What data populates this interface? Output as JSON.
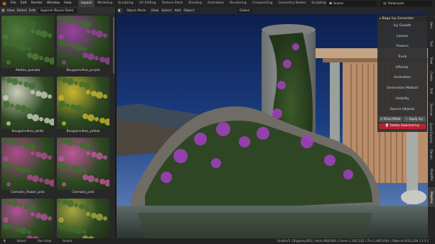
{
  "menubar": {
    "menus": [
      "File",
      "Edit",
      "Render",
      "Window",
      "Help"
    ],
    "workspaces": [
      "Layout",
      "Modeling",
      "Sculpting",
      "UV Editing",
      "Texture Paint",
      "Shading",
      "Animation",
      "Rendering",
      "Compositing",
      "Geometry Nodes",
      "Scripting"
    ],
    "active_workspace": "Layout",
    "scene": "Scene",
    "view_layer": "ViewLayer"
  },
  "asset_browser": {
    "header": {
      "view": "View",
      "select": "Select",
      "edit": "Edit",
      "import_mode": "Append (Reuse Data)"
    },
    "assets": [
      {
        "label": "Akebia_quinata",
        "palette": "#4e7a3a"
      },
      {
        "label": "Bougainvillea_purple",
        "palette": "#9b3fa3"
      },
      {
        "label": "Bougainvillea_white",
        "palette": "#c9cdb9"
      },
      {
        "label": "Bougainvillea_yellow",
        "palette": "#c7b62f"
      },
      {
        "label": "Clematis_flower_pink",
        "palette": "#b04a8e"
      },
      {
        "label": "Clematis_pink",
        "palette": "#c0569c"
      },
      {
        "label": "",
        "palette": "#b4509a"
      },
      {
        "label": "",
        "palette": "#a9a540"
      }
    ]
  },
  "viewport": {
    "header": {
      "view_icon": "cube-icon",
      "mode": "Object Mode",
      "view": "View",
      "select": "Select",
      "add": "Add",
      "object": "Object",
      "orientation": "Global"
    }
  },
  "baga_panel": {
    "title": "Baga Ivy Generator",
    "buttons": [
      "Ivy Growth",
      "Leaves",
      "Flowers",
      "Trunk",
      "Effector",
      "Animation",
      "Generation Method",
      "Visibility",
      "Source Objects"
    ],
    "draw_mode": "Draw Mode",
    "apply_ivy": "Apply Ivy",
    "delete_selected": "Delete Selected Ivy",
    "colors": {
      "delete": "#b3232f"
    }
  },
  "side_tabs": [
    "Item",
    "Tool",
    "View",
    "Create",
    "Edit",
    "Services",
    "Quick Exports",
    "Decals",
    "BagaPie",
    "BagaIvy"
  ],
  "active_side_tab": "BagaIvy",
  "statusbar": {
    "select": "Select",
    "pan_view": "Pan View",
    "select2": "Select",
    "stats": "Scatter5 | BagaIvy.003 | Verts:984,606 | Faces:1,192,532 | Tris:1,665,644 | Objects:0/10,208 | 3.3.1"
  }
}
